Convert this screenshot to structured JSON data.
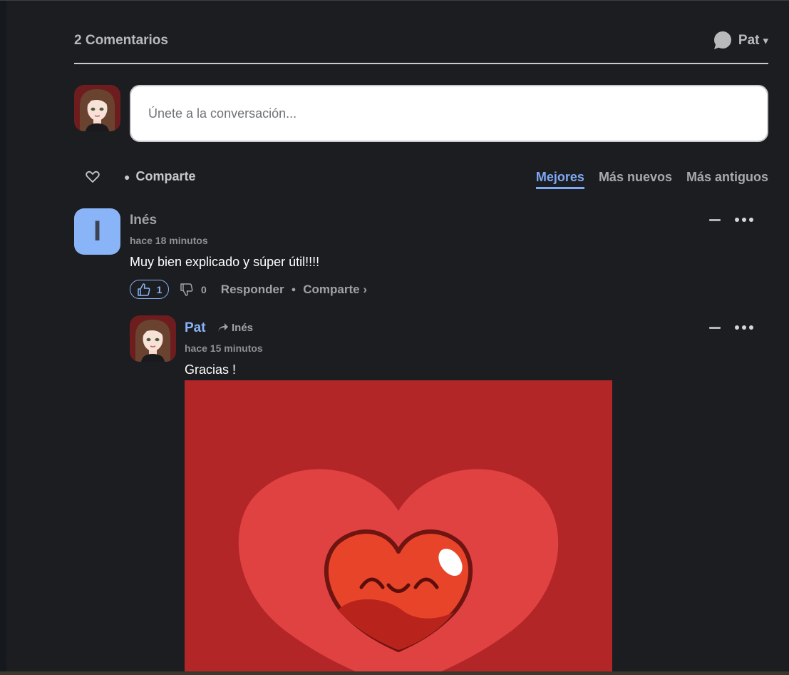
{
  "header": {
    "comment_count": "2 Comentarios",
    "user_name": "Pat",
    "caret": "▾"
  },
  "composer": {
    "placeholder": "Únete a la conversación..."
  },
  "toolbar": {
    "share_label": "Comparte",
    "sort_tabs": [
      "Mejores",
      "Más nuevos",
      "Más antiguos"
    ],
    "active_sort": "Mejores"
  },
  "comments": [
    {
      "avatar_letter": "I",
      "author": "Inés",
      "time": "hace 18 minutos",
      "text": "Muy bien explicado y súper útil!!!!",
      "upvotes": "1",
      "downvotes": "0",
      "reply_label": "Responder",
      "share_label": "Comparte ›",
      "replies": [
        {
          "author": "Pat",
          "reply_to": "Inés",
          "time": "hace 15 minutos",
          "text": "Gracias !",
          "attachment": "smiling-heart-gif"
        }
      ]
    }
  ],
  "colors": {
    "background": "#1c1d20",
    "accent": "#8ab4f8",
    "gif_background": "#b32628"
  }
}
